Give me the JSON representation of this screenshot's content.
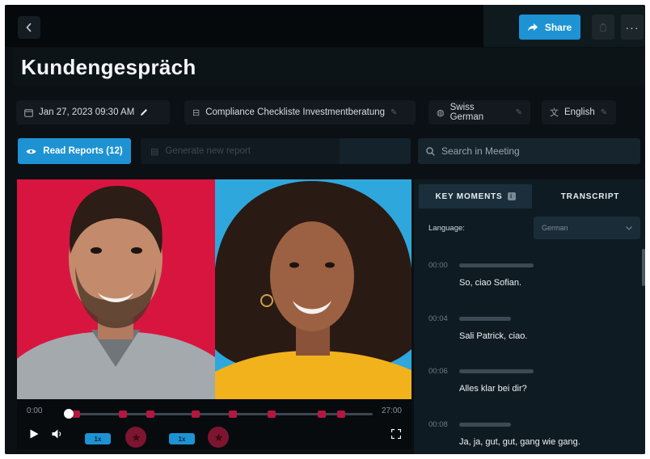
{
  "header": {
    "share_label": "Share",
    "title": "Kundengespräch"
  },
  "meta": {
    "date": "Jan 27, 2023 09:30 AM",
    "checklist": "Compliance Checkliste Investmentberatung",
    "audio_language": "Swiss German",
    "translation_language": "English"
  },
  "actions": {
    "read_reports_label": "Read Reports (12)",
    "generate_placeholder": "Generate new report",
    "search_placeholder": "Search in Meeting"
  },
  "player": {
    "time_start": "0:00",
    "time_end": "27:00",
    "speed_1": "1x",
    "speed_2": "1x",
    "progress": 0
  },
  "panel": {
    "tab_key_moments": "KEY MOMENTS",
    "tab_transcript": "TRANSCRIPT",
    "language_label": "Language:",
    "language_value": "German",
    "entries": [
      {
        "time": "00:00",
        "text": "So, ciao Sofian."
      },
      {
        "time": "00:04",
        "text": "Sali Patrick, ciao."
      },
      {
        "time": "00:06",
        "text": "Alles klar bei dir?"
      },
      {
        "time": "00:08",
        "text": "Ja, ja, gut, gut, gang wie gang."
      }
    ]
  },
  "colors": {
    "accent": "#1e93d3",
    "marker": "#b3173f",
    "background": "#0a1014"
  }
}
